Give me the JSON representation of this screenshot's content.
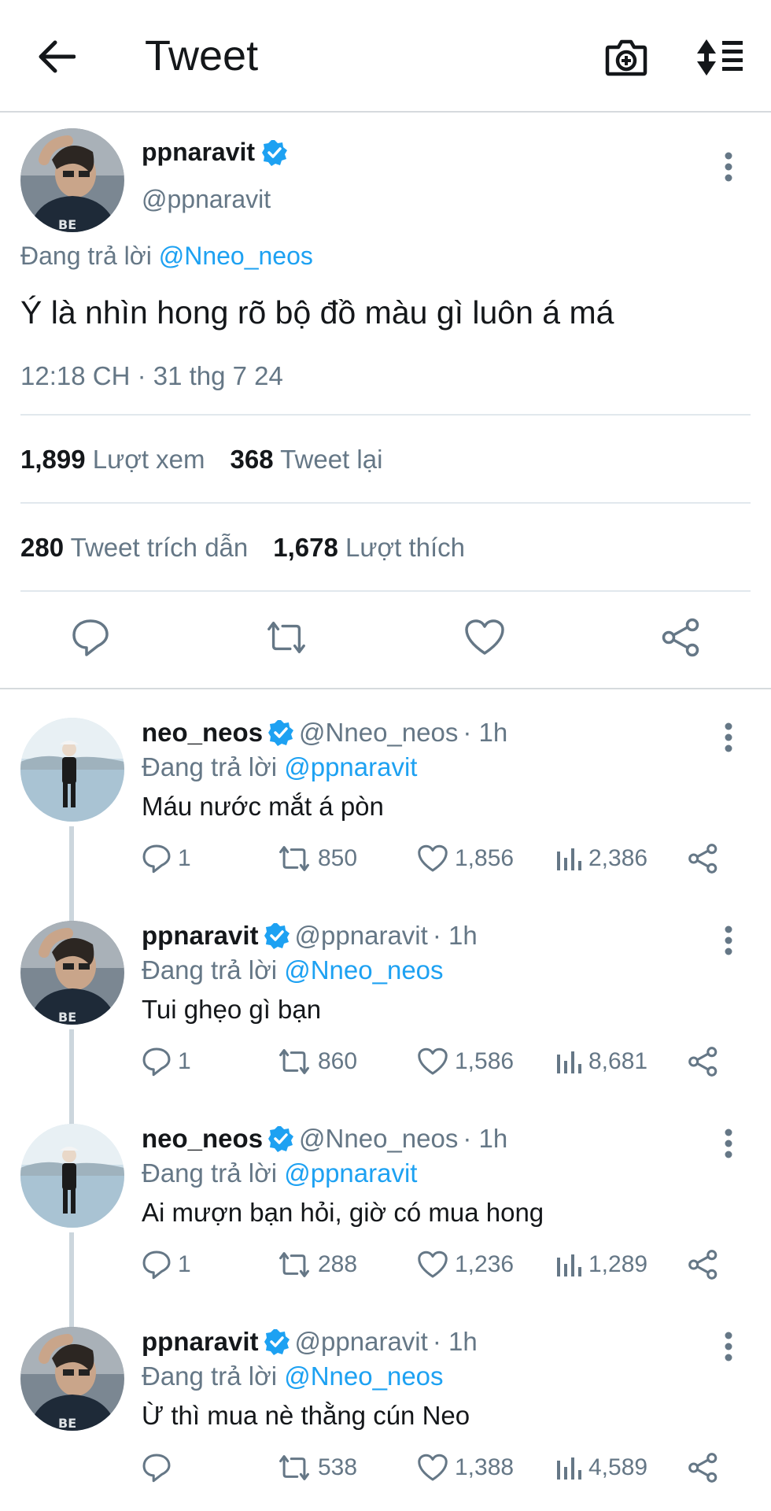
{
  "header": {
    "title": "Tweet"
  },
  "main_tweet": {
    "name": "ppnaravit",
    "handle": "@ppnaravit",
    "replying_prefix": "Đang trả lời",
    "replying_to": "@Nneo_neos",
    "text": "Ý là nhìn hong rõ bộ đồ màu gì luôn á má",
    "timestamp": "12:18 CH · 31 thg 7 24",
    "stats": {
      "views_count": "1,899",
      "views_label": "Lượt xem",
      "retweets_count": "368",
      "retweets_label": "Tweet lại",
      "quotes_count": "280",
      "quotes_label": "Tweet trích dẫn",
      "likes_count": "1,678",
      "likes_label": "Lượt thích"
    }
  },
  "replies": [
    {
      "name": "neo_neos",
      "handle": "@Nneo_neos",
      "time": "· 1h",
      "replying_prefix": "Đang trả lời",
      "replying_to": "@ppnaravit",
      "text": "Máu nước mắt á pòn",
      "replies": "1",
      "retweets": "850",
      "likes": "1,856",
      "views": "2,386",
      "avatar": "neo"
    },
    {
      "name": "ppnaravit",
      "handle": "@ppnaravit",
      "time": "· 1h",
      "replying_prefix": "Đang trả lời",
      "replying_to": "@Nneo_neos",
      "text": "Tui ghẹo gì bạn",
      "replies": "1",
      "retweets": "860",
      "likes": "1,586",
      "views": "8,681",
      "avatar": "pp"
    },
    {
      "name": "neo_neos",
      "handle": "@Nneo_neos",
      "time": "· 1h",
      "replying_prefix": "Đang trả lời",
      "replying_to": "@ppnaravit",
      "text": "Ai mượn bạn hỏi, giờ có mua hong",
      "replies": "1",
      "retweets": "288",
      "likes": "1,236",
      "views": "1,289",
      "avatar": "neo"
    },
    {
      "name": "ppnaravit",
      "handle": "@ppnaravit",
      "time": "· 1h",
      "replying_prefix": "Đang trả lời",
      "replying_to": "@Nneo_neos",
      "text": "Ừ thì mua nè thằng cún Neo",
      "replies": "",
      "retweets": "538",
      "likes": "1,388",
      "views": "4,589",
      "avatar": "pp"
    }
  ],
  "colors": {
    "accent": "#1da1f2",
    "secondary_text": "#657786",
    "primary_text": "#14171a",
    "divider": "#e1e8ed"
  },
  "icons": [
    "back-arrow-icon",
    "camera-plus-icon",
    "sort-icon",
    "verified-badge-icon",
    "more-vertical-icon",
    "reply-icon",
    "retweet-icon",
    "like-icon",
    "share-icon",
    "views-icon"
  ]
}
